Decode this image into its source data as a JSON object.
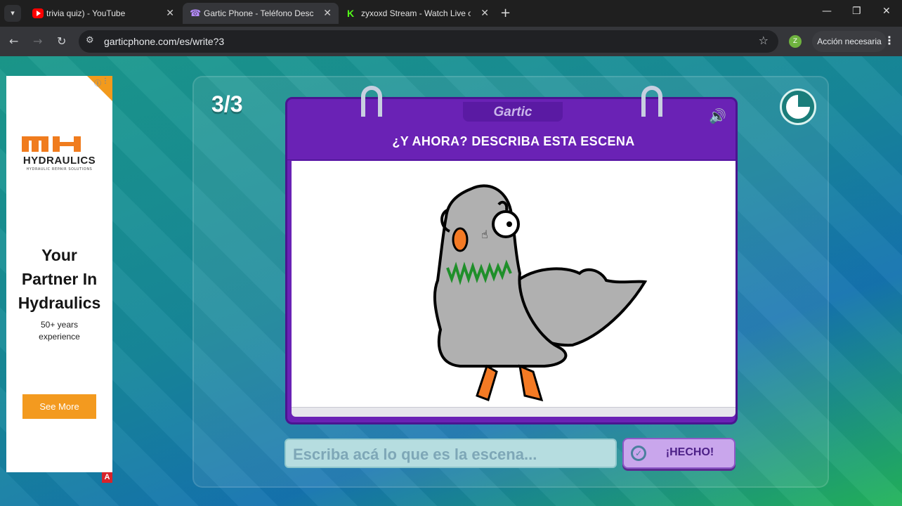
{
  "browser": {
    "tabs": [
      {
        "title": "trivia quiz) - YouTube",
        "icon": "youtube-icon"
      },
      {
        "title": "Gartic Phone - Teléfono Descom",
        "icon": "gartic-phone-icon"
      },
      {
        "title": "zyxoxd Stream - Watch Live on",
        "icon": "kick-icon"
      }
    ],
    "url": "garticphone.com/es/write?3",
    "profile_initial": "Z",
    "update_label": "Acción necesaria"
  },
  "ad": {
    "brand": "HYDRAULICS",
    "brand_sub": "HYDRAULIC REPAIR SOLUTIONS",
    "headline_1": "Your",
    "headline_2": "Partner In",
    "headline_3": "Hydraulics",
    "body_1": "50+ years",
    "body_2": "experience",
    "cta": "See More",
    "badge": "A"
  },
  "game": {
    "round": "3/3",
    "logo": "Gartic",
    "prompt": "¿Y AHORA? DESCRIBA ESTA ESCENA",
    "timer_remaining_fraction": 0.75,
    "answer_placeholder": "Escriba acá lo que es la escena...",
    "done_label": "¡HECHO!"
  },
  "colors": {
    "notebook_purple": "#6a22b5",
    "done_button": "#c9a6ec",
    "ad_orange": "#f29a1c"
  }
}
